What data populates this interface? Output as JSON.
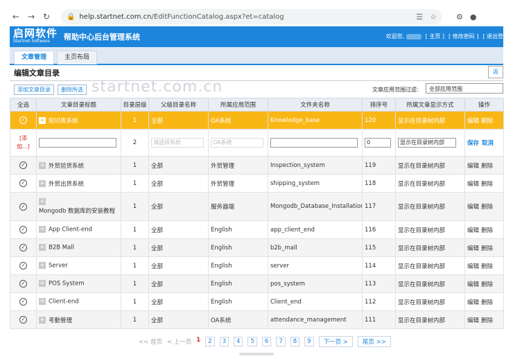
{
  "browser": {
    "url_host": "help.startnet.com.cn",
    "url_path": "/EditFunctionCatalog.aspx?et=catalog"
  },
  "header": {
    "logo_cn": "启网软件",
    "logo_en": "Startnet Software",
    "system_title": "帮助中心后台管理系统",
    "welcome": "欢迎您,",
    "home_link": "[ 主页 ]",
    "change_pwd_link": "[ 修改密码 ]",
    "logout_link": "[ 退出登"
  },
  "tabs": [
    {
      "label": "文章管理",
      "active": true
    },
    {
      "label": "主页布局",
      "active": false
    }
  ],
  "page": {
    "title": "编辑文章目录",
    "back_label": "返",
    "add_button": "添加文章目录",
    "delete_button": "删除所选",
    "watermark": "startnet.com.cn",
    "filter_label": "文章应用范围过滤:",
    "filter_value": "全部应用范围"
  },
  "table": {
    "headers": [
      "全选",
      "文章目录标题",
      "目录层级",
      "父级目录名称",
      "所属应用范围",
      "文件夹名称",
      "排序号",
      "所属文章显示方式",
      "操作"
    ],
    "selected_row": {
      "title": "知识库系统",
      "level": "1",
      "parent": "全部",
      "scope": "OA系统",
      "folder": "Knowledge_base",
      "order": "120",
      "display": "显示在目录树内部",
      "ops": [
        "编辑",
        "删除"
      ]
    },
    "add_row": {
      "add_label_1": "[添",
      "add_label_2": "加...]",
      "level": "2",
      "parent_placeholder": "请选择系统",
      "scope_placeholder": "OA系统",
      "order_value": "0",
      "display_value": "显示在目录树内部",
      "save": "保存",
      "cancel": "取消"
    },
    "rows": [
      {
        "title": "外贸验货系统",
        "level": "1",
        "parent": "全部",
        "scope": "外贸管理",
        "folder": "Inspection_system",
        "order": "119",
        "display": "显示在目录树内部",
        "edit": "编辑",
        "del": "删除"
      },
      {
        "title": "外贸出货系统",
        "level": "1",
        "parent": "全部",
        "scope": "外贸管理",
        "folder": "shipping_system",
        "order": "118",
        "display": "显示在目录树内部",
        "edit": "编辑",
        "del": "删除"
      },
      {
        "title": "Mongodb 数据库的安装教程",
        "level": "1",
        "parent": "全部",
        "scope": "服务器端",
        "folder": "Mongodb_Database_Installation",
        "order": "117",
        "display": "显示在目录树内部",
        "edit": "编辑",
        "del": "删除"
      },
      {
        "title": "App Client-end",
        "level": "1",
        "parent": "全部",
        "scope": "English",
        "folder": "app_client_end",
        "order": "116",
        "display": "显示在目录树内部",
        "edit": "编辑",
        "del": "删除"
      },
      {
        "title": "B2B Mall",
        "level": "1",
        "parent": "全部",
        "scope": "English",
        "folder": "b2b_mall",
        "order": "115",
        "display": "显示在目录树内部",
        "edit": "编辑",
        "del": "删除"
      },
      {
        "title": "Server",
        "level": "1",
        "parent": "全部",
        "scope": "English",
        "folder": "server",
        "order": "114",
        "display": "显示在目录树内部",
        "edit": "编辑",
        "del": "删除"
      },
      {
        "title": "POS System",
        "level": "1",
        "parent": "全部",
        "scope": "English",
        "folder": "pos_system",
        "order": "113",
        "display": "显示在目录树内部",
        "edit": "编辑",
        "del": "删除"
      },
      {
        "title": "Client-end",
        "level": "1",
        "parent": "全部",
        "scope": "English",
        "folder": "Client_end",
        "order": "112",
        "display": "显示在目录树内部",
        "edit": "编辑",
        "del": "删除"
      },
      {
        "title": "考勤管理",
        "level": "1",
        "parent": "全部",
        "scope": "OA系统",
        "folder": "attendance_management",
        "order": "111",
        "display": "显示在目录树内部",
        "edit": "编辑",
        "del": "删除"
      }
    ]
  },
  "pager": {
    "first": "<< 首页",
    "prev": "< 上一页",
    "pages": [
      "1",
      "2",
      "3",
      "4",
      "5",
      "6",
      "7",
      "8",
      "9"
    ],
    "current": "1",
    "next": "下一页 >",
    "last": "尾页 >>"
  }
}
